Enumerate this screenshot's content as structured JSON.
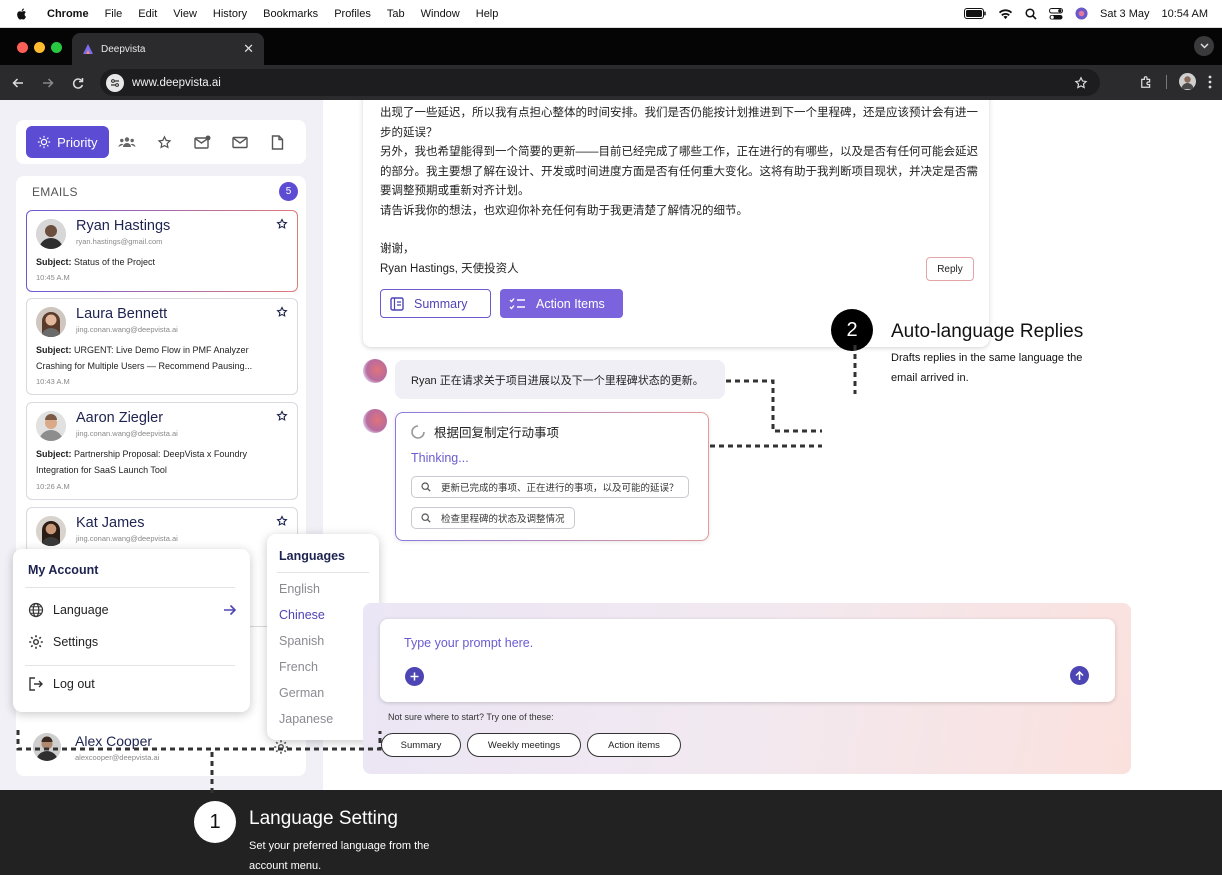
{
  "menubar": {
    "app": "Chrome",
    "items": [
      "File",
      "Edit",
      "View",
      "History",
      "Bookmarks",
      "Profiles",
      "Tab",
      "Window",
      "Help"
    ],
    "date": "Sat 3 May",
    "time": "10:54 AM"
  },
  "browser": {
    "tab_title": "Deepvista",
    "url": "www.deepvista.ai"
  },
  "sidebar": {
    "priority_label": "Priority",
    "filter_icons": [
      "people-icon",
      "star-icon",
      "mail-badge-icon",
      "mail-icon",
      "document-icon"
    ],
    "emails_header": "EMAILS",
    "emails_count": "5",
    "emails": [
      {
        "name": "Ryan Hastings",
        "address": "ryan.hastings@gmail.com",
        "subject_label": "Subject:",
        "subject": " Status of the Project",
        "time": "10:45 A.M"
      },
      {
        "name": "Laura Bennett",
        "address": "jing.conan.wang@deepvista.ai",
        "subject_label": "Subject:",
        "subject": " URGENT: Live Demo Flow in PMF Analyzer Crashing for Multiple Users — Recommend Pausing...",
        "time": "10:43 A.M"
      },
      {
        "name": "Aaron Ziegler",
        "address": "jing.conan.wang@deepvista.ai",
        "subject_label": "Subject:",
        "subject": " Partnership Proposal: DeepVista x Foundry Integration for SaaS Launch Tool",
        "time": "10:26 A.M"
      },
      {
        "name": "Kat James",
        "address": "jing.conan.wang@deepvista.ai"
      }
    ],
    "account": {
      "name": "Alex Cooper",
      "email": "alexcooper@deepvista.ai"
    }
  },
  "account_menu": {
    "title": "My Account",
    "language": "Language",
    "settings": "Settings",
    "logout": "Log out"
  },
  "language_menu": {
    "title": "Languages",
    "options": [
      "English",
      "Chinese",
      "Spanish",
      "French",
      "German",
      "Japanese"
    ],
    "selected": "Chinese"
  },
  "email_view": {
    "lines": [
      "出现了一些延迟，所以我有点担心整体的时间安排。我们是否仍能按计划推进到下一个里程碑，还是应该预计会有进一",
      "步的延误？",
      "另外，我也希望能得到一个简要的更新——目前已经完成了哪些工作，正在进行的有哪些，以及是否有任何可能会延迟",
      "的部分。我主要想了解在设计、开发或时间进度方面是否有任何重大变化。这将有助于我判断项目现状，并决定是否需",
      "要调整预期或重新对齐计划。",
      "请告诉我你的想法，也欢迎你补充任何有助于我更清楚了解情况的细节。",
      "谢谢，",
      "Ryan Hastings, 天使投资人"
    ],
    "reply_label": "Reply",
    "summary_label": "Summary",
    "action_items_label": "Action Items"
  },
  "assistant": {
    "message": "Ryan 正在请求关于项目进展以及下一个里程碑状态的更新。",
    "task_title": "根据回复制定行动事项",
    "thinking": "Thinking...",
    "queries": [
      "更新已完成的事项、正在进行的事项，以及可能的延误？",
      "检查里程碑的状态及调整情况"
    ]
  },
  "prompt": {
    "placeholder": "Type your prompt here.",
    "suggest_label": "Not sure where to start? Try one of these:",
    "suggestions": [
      "Summary",
      "Weekly meetings",
      "Action items"
    ]
  },
  "callouts": [
    {
      "number": "1",
      "title": "Language Setting",
      "description": "Set your preferred language from the account menu."
    },
    {
      "number": "2",
      "title": "Auto-language Replies",
      "description": "Drafts replies in the same language the email arrived in."
    }
  ],
  "colors": {
    "accent": "#5c4bd3",
    "accent_light": "#7a63dd",
    "highlight_red": "#e07a7a",
    "callout_dark": "#222222"
  }
}
